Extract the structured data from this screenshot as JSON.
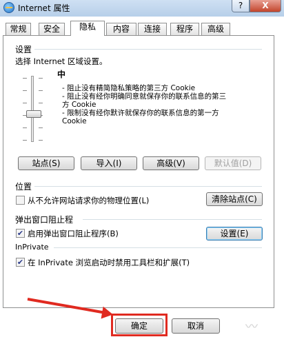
{
  "window": {
    "title": "Internet 属性",
    "help_label": "?",
    "close_label": "X"
  },
  "tabs": [
    {
      "label": "常规"
    },
    {
      "label": "安全"
    },
    {
      "label": "隐私"
    },
    {
      "label": "内容"
    },
    {
      "label": "连接"
    },
    {
      "label": "程序"
    },
    {
      "label": "高级"
    }
  ],
  "active_tab": "隐私",
  "settings": {
    "group_label": "设置",
    "prompt": "选择 Internet 区域设置。",
    "slider_level_name": "中",
    "slider_position_fraction": 0.5,
    "description": [
      "- 阻止没有精简隐私策略的第三方 Cookie",
      "- 阻止没有经你明确同意就保存你的联系信息的第三",
      "方 Cookie",
      "- 限制没有经你默许就保存你的联系信息的第一方",
      "Cookie"
    ],
    "buttons": {
      "sites": "站点(S)",
      "import": "导入(I)",
      "advanced": "高级(V)",
      "default": "默认值(D)"
    }
  },
  "location": {
    "group_label": "位置",
    "checkbox_label": "从不允许网站请求你的物理位置(L)",
    "checked": false,
    "clear_button": "清除站点(C)"
  },
  "popup": {
    "group_label": "弹出窗口阻止程",
    "checkbox_label": "启用弹出窗口阻止程序(B)",
    "checked": true,
    "settings_button": "设置(E)"
  },
  "inprivate": {
    "group_label": "InPrivate",
    "checkbox_label": "在 InPrivate 浏览启动时禁用工具栏和扩展(T)",
    "checked": true
  },
  "footer": {
    "ok": "确定",
    "cancel": "取消"
  },
  "watermark": "〰",
  "colors": {
    "annotation_red": "#e02a20",
    "titlebar": "#b7cfe9"
  }
}
